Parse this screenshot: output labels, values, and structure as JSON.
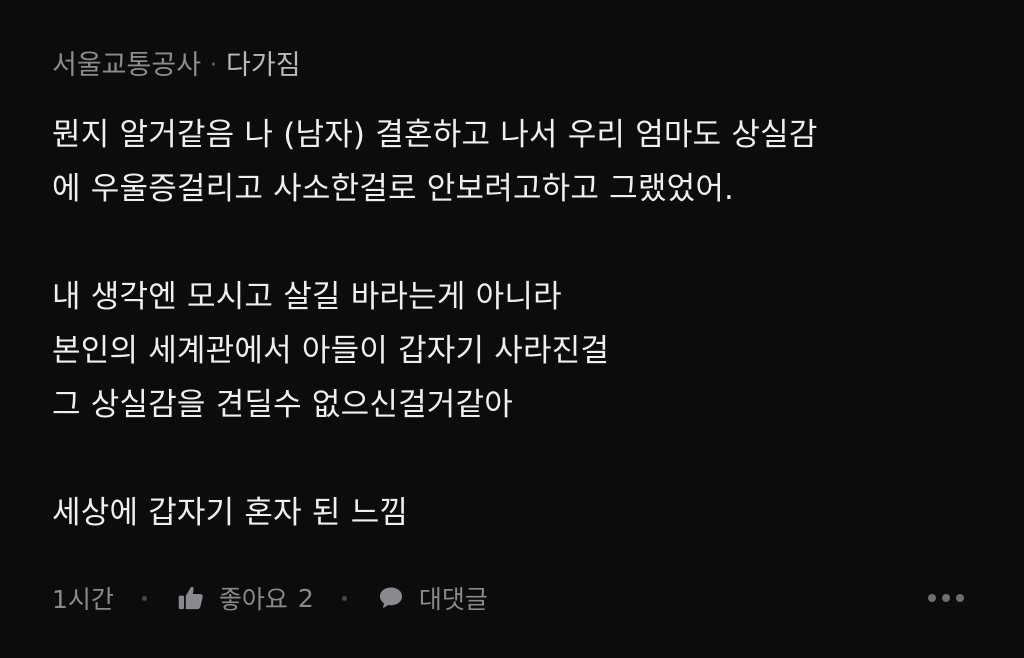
{
  "header": {
    "company": "서울교통공사",
    "separator": "·",
    "nickname": "다가짐"
  },
  "comment": {
    "paragraphs": [
      [
        "뭔지 알거같음 나 (남자) 결혼하고 나서 우리 엄마도 상실감",
        "에 우울증걸리고 사소한걸로 안보려고하고 그랬었어."
      ],
      [
        "내 생각엔 모시고 살길 바라는게 아니라",
        "본인의 세계관에서 아들이 갑자기 사라진걸",
        "그 상실감을 견딜수 없으신걸거같아"
      ],
      [
        "세상에 갑자기 혼자 된 느낌"
      ]
    ]
  },
  "footer": {
    "time": "1시간",
    "like_label": "좋아요",
    "like_count": "2",
    "reply_label": "대댓글",
    "icons": {
      "like": "thumbs-up-icon",
      "reply": "speech-bubble-icon",
      "more": "more-horizontal-icon"
    }
  },
  "colors": {
    "background": "#0c0c0d",
    "text": "#efefef",
    "muted": "#8a8a8e"
  }
}
